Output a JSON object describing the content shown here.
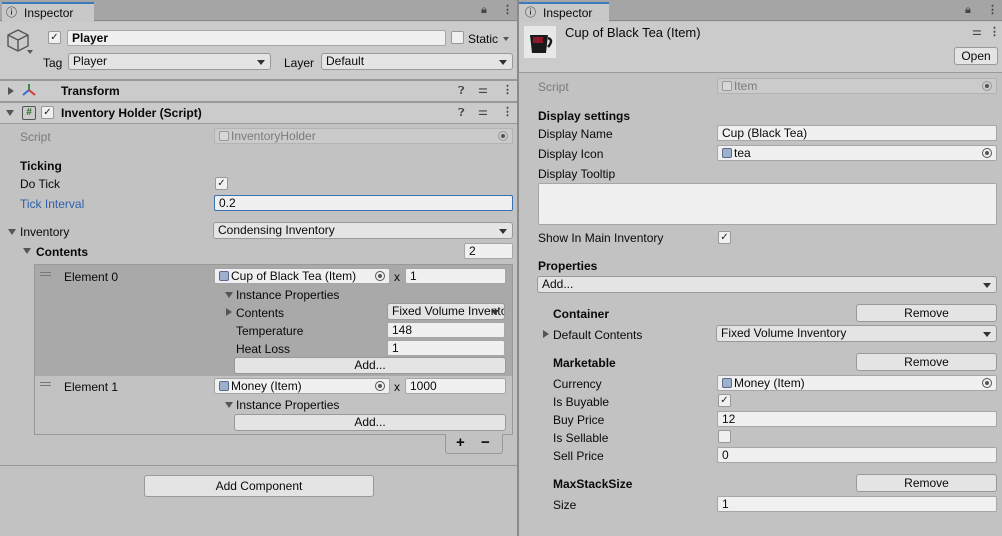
{
  "left": {
    "tab_title": "Inspector",
    "object_name": "Player",
    "static_label": "Static",
    "tag_label": "Tag",
    "tag_value": "Player",
    "layer_label": "Layer",
    "layer_value": "Default",
    "transform_title": "Transform",
    "script_component_title": "Inventory Holder (Script)",
    "script_label": "Script",
    "script_value": "InventoryHolder",
    "ticking_header": "Ticking",
    "do_tick_label": "Do Tick",
    "tick_interval_label": "Tick Interval",
    "tick_interval_value": "0.2",
    "inventory_label": "Inventory",
    "inventory_value": "Condensing Inventory",
    "contents_label": "Contents",
    "contents_count": "2",
    "element0": {
      "label": "Element 0",
      "item": "Cup of Black Tea (Item)",
      "x": "x",
      "qty": "1",
      "instance_props": "Instance Properties",
      "contents_label": "Contents",
      "contents_value": "Fixed Volume Inventory",
      "temperature_label": "Temperature",
      "temperature_value": "148",
      "heat_loss_label": "Heat Loss",
      "heat_loss_value": "1",
      "add_label": "Add..."
    },
    "element1": {
      "label": "Element 1",
      "item": "Money (Item)",
      "x": "x",
      "qty": "1000",
      "instance_props": "Instance Properties",
      "add_label": "Add..."
    },
    "plus": "+",
    "minus": "−",
    "add_component": "Add Component"
  },
  "right": {
    "tab_title": "Inspector",
    "asset_title": "Cup of Black Tea (Item)",
    "open_label": "Open",
    "script_label": "Script",
    "script_value": "Item",
    "display_settings": "Display settings",
    "display_name_label": "Display Name",
    "display_name_value": "Cup (Black Tea)",
    "display_icon_label": "Display Icon",
    "display_icon_value": "tea",
    "display_tooltip_label": "Display Tooltip",
    "show_in_main_label": "Show In Main Inventory",
    "properties_header": "Properties",
    "add_dropdown": "Add...",
    "container_header": "Container",
    "remove_label": "Remove",
    "default_contents_label": "Default Contents",
    "default_contents_value": "Fixed Volume Inventory",
    "marketable_header": "Marketable",
    "currency_label": "Currency",
    "currency_value": "Money (Item)",
    "is_buyable_label": "Is Buyable",
    "buy_price_label": "Buy Price",
    "buy_price_value": "12",
    "is_sellable_label": "Is Sellable",
    "sell_price_label": "Sell Price",
    "sell_price_value": "0",
    "maxstack_header": "MaxStackSize",
    "size_label": "Size",
    "size_value": "1"
  },
  "icons": [
    "info-icon",
    "lock-icon",
    "kebab-icon",
    "help-icon",
    "sliders-icon",
    "transform-icon",
    "script-icon",
    "target-icon"
  ]
}
